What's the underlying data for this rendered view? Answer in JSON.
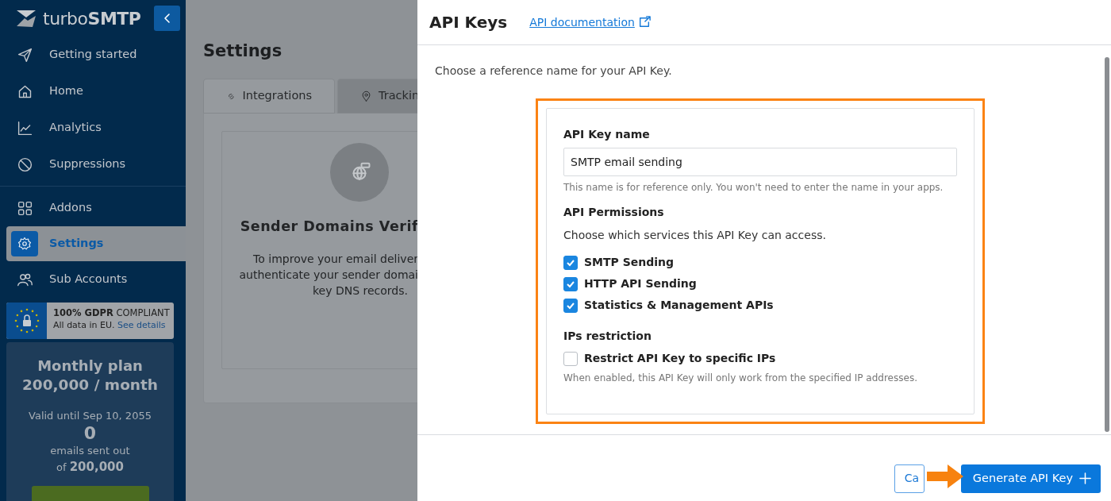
{
  "sidebar": {
    "logo": "turbo**SMTP**",
    "nav_groups": [
      [
        {
          "label": "Getting started",
          "selected": false
        },
        {
          "label": "Home",
          "selected": false
        },
        {
          "label": "Analytics",
          "selected": false
        },
        {
          "label": "Suppressions",
          "selected": false
        }
      ],
      [
        {
          "label": "Addons",
          "selected": false
        },
        {
          "label": "Settings",
          "selected": true
        },
        {
          "label": "Sub Accounts",
          "selected": false
        }
      ]
    ],
    "gdpr": {
      "title": "**100% GDPR** COMPLIANT",
      "text": "All data in EU.",
      "link": "See details"
    },
    "plan": {
      "title": "Monthly plan",
      "amount": "200,000 / month",
      "valid": "Valid until Sep 10, 2055",
      "sent": "0",
      "sent_label": "emails sent out",
      "total": "of **200,000**"
    }
  },
  "page": {
    "title": "Settings",
    "tabs": [
      {
        "label": "Integrations",
        "selected": true
      },
      {
        "label": "Trackin",
        "selected": false
      }
    ],
    "card": {
      "title": "Sender Domains Verif",
      "lines": [
        "To improve your email deliver",
        "authenticate your sender domai",
        "key DNS records."
      ]
    }
  },
  "panel": {
    "title": "API Keys",
    "doc_link": "API documentation",
    "intro": "Choose a reference name for your API Key.",
    "form": {
      "name_label": "API Key name",
      "name_value": "SMTP email sending",
      "name_help": "This name is for reference only. You won't need to enter the name in your apps.",
      "permissions_label": "API Permissions",
      "permissions_intro": "Choose which services this API Key can access.",
      "permissions": [
        {
          "label": "SMTP Sending",
          "checked": true
        },
        {
          "label": "HTTP API Sending",
          "checked": true
        },
        {
          "label": "Statistics & Management APIs",
          "checked": true
        }
      ],
      "ip_label": "IPs restriction",
      "ip_option": {
        "label": "Restrict API Key to specific IPs",
        "checked": false
      },
      "ip_help": "When enabled, this API Key will only work from the specified IP addresses."
    },
    "buttons": {
      "cancel": "Ca",
      "generate": "Generate API Key"
    }
  }
}
